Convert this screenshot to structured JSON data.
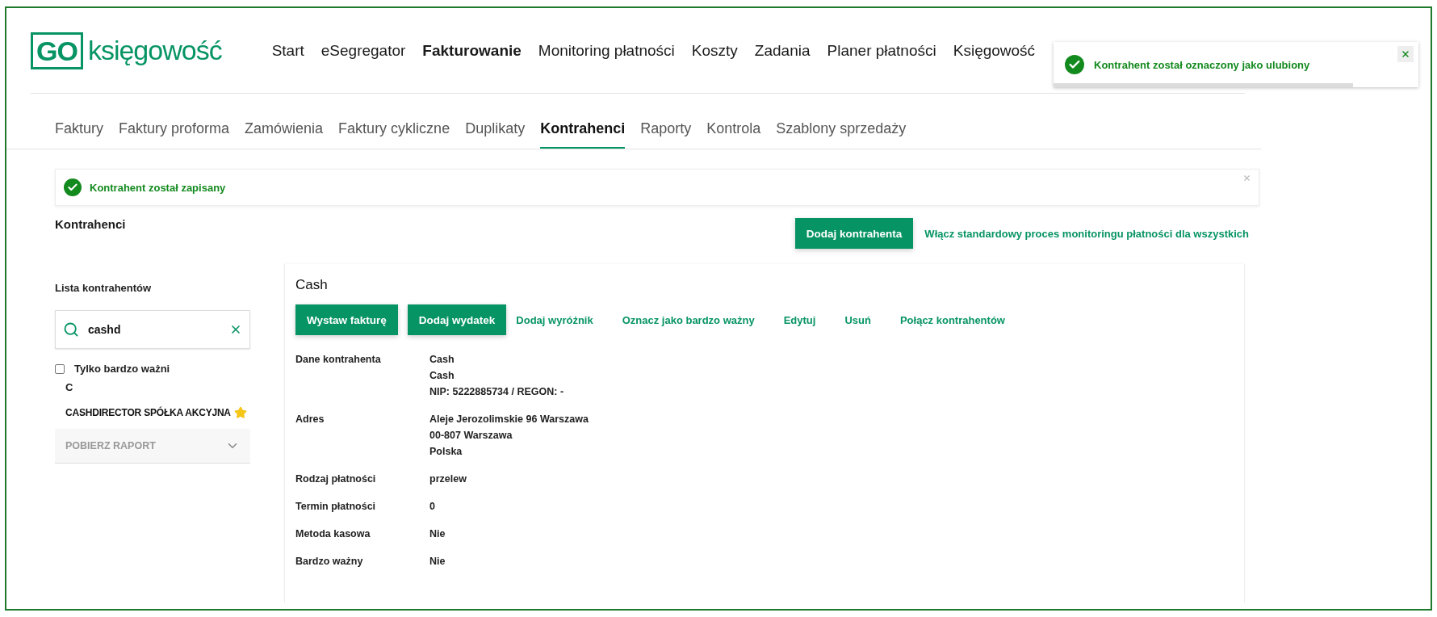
{
  "logo": {
    "badge": "GO",
    "text": "księgowość"
  },
  "main_nav": [
    {
      "label": "Start",
      "selected": false
    },
    {
      "label": "eSegregator",
      "selected": false
    },
    {
      "label": "Fakturowanie",
      "selected": true
    },
    {
      "label": "Monitoring płatności",
      "selected": false
    },
    {
      "label": "Koszty",
      "selected": false
    },
    {
      "label": "Zadania",
      "selected": false
    },
    {
      "label": "Planer płatności",
      "selected": false
    },
    {
      "label": "Księgowość",
      "selected": false
    }
  ],
  "toast": {
    "message": "Kontrahent został oznaczony jako ulubiony",
    "level": 0.82
  },
  "sub_tabs": [
    {
      "label": "Faktury",
      "selected": false
    },
    {
      "label": "Faktury proforma",
      "selected": false
    },
    {
      "label": "Zamówienia",
      "selected": false
    },
    {
      "label": "Faktury cykliczne",
      "selected": false
    },
    {
      "label": "Duplikaty",
      "selected": false
    },
    {
      "label": "Kontrahenci",
      "selected": true
    },
    {
      "label": "Raporty",
      "selected": false
    },
    {
      "label": "Kontrola",
      "selected": false
    },
    {
      "label": "Szablony sprzedaży",
      "selected": false
    }
  ],
  "alert": {
    "message": "Kontrahent został zapisany"
  },
  "page_title": "Kontrahenci",
  "actions": {
    "add_button": "Dodaj kontrahenta",
    "monitoring_link": "Włącz standardowy proces monitoringu płatności dla wszystkich"
  },
  "sidebar": {
    "title": "Lista kontrahentów",
    "search": {
      "value": "cashd"
    },
    "filter": {
      "label": "Tylko bardzo ważni",
      "checked": false
    },
    "groups": [
      {
        "letter": "C",
        "items": [
          {
            "name": "CASHDIRECTOR SPÓŁKA AKCYJNA",
            "favorite": true
          }
        ]
      }
    ],
    "report": {
      "label": "POBIERZ RAPORT",
      "expanded": false
    }
  },
  "detail": {
    "title": "Cash",
    "actions": [
      {
        "label": "Wystaw fakturę",
        "kind": "primary"
      },
      {
        "label": "Dodaj wydatek",
        "kind": "primary"
      },
      {
        "label": "Dodaj wyróżnik",
        "kind": "link"
      },
      {
        "label": "Oznacz jako bardzo ważny",
        "kind": "link"
      },
      {
        "label": "Edytuj",
        "kind": "link"
      },
      {
        "label": "Usuń",
        "kind": "link"
      },
      {
        "label": "Połącz kontrahentów",
        "kind": "link"
      }
    ],
    "fields": [
      {
        "label": "Dane kontrahenta",
        "values": [
          "Cash",
          "Cash",
          "NIP: 5222885734 / REGON: -"
        ]
      },
      {
        "label": "Adres",
        "values": [
          "Aleje Jerozolimskie 96 Warszawa",
          "00-807 Warszawa",
          "Polska"
        ]
      },
      {
        "label": "Rodzaj płatności",
        "values": [
          "przelew"
        ]
      },
      {
        "label": "Termin płatności",
        "values": [
          "0"
        ]
      },
      {
        "label": "Metoda kasowa",
        "values": [
          "Nie"
        ]
      },
      {
        "label": "Bardzo ważny",
        "values": [
          "Nie"
        ]
      }
    ]
  }
}
